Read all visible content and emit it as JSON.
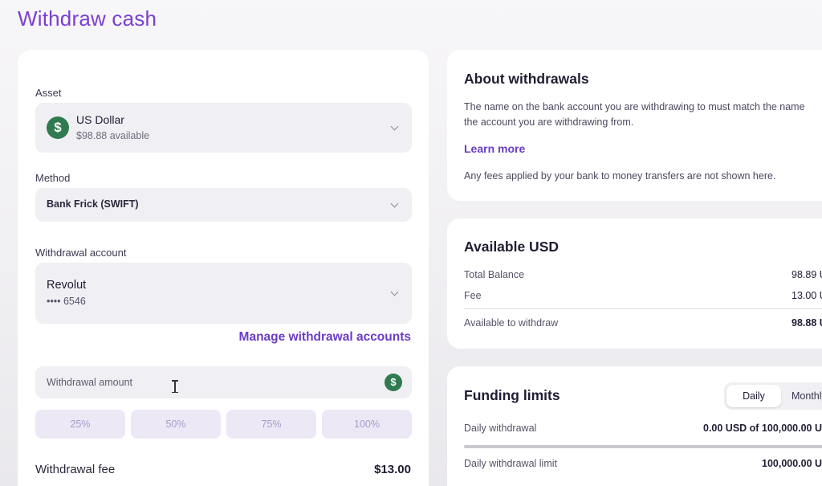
{
  "page": {
    "title": "Withdraw cash"
  },
  "form": {
    "asset_label": "Asset",
    "asset": {
      "name": "US Dollar",
      "available": "$98.88 available",
      "icon": "dollar-icon",
      "icon_color": "#2f7a4f"
    },
    "method_label": "Method",
    "method_value": "Bank Frick (SWIFT)",
    "account_label": "Withdrawal account",
    "account": {
      "name": "Revolut",
      "number": "•••• 6546"
    },
    "manage_link": "Manage withdrawal accounts",
    "amount_placeholder": "Withdrawal amount",
    "percent_buttons": [
      "25%",
      "50%",
      "75%",
      "100%"
    ],
    "fee_label": "Withdrawal fee",
    "fee_value": "$13.00"
  },
  "about": {
    "title": "About withdrawals",
    "text_line1": "The name on the bank account you are withdrawing to must match the name",
    "text_line2": "the account you are withdrawing from.",
    "learn_more": "Learn more",
    "fees_note": "Any fees applied by your bank to money transfers are not shown here."
  },
  "available": {
    "title": "Available USD",
    "rows": [
      {
        "label": "Total Balance",
        "value": "98.89 U"
      },
      {
        "label": "Fee",
        "value": "13.00 U"
      },
      {
        "label": "Available to withdraw",
        "value": "98.88 U"
      }
    ]
  },
  "limits": {
    "title": "Funding limits",
    "toggle": {
      "daily": "Daily",
      "monthly": "Monthly"
    },
    "daily_withdrawal_label": "Daily withdrawal",
    "daily_withdrawal_value": "0.00 USD of 100,000.00 U",
    "daily_limit_label": "Daily withdrawal limit",
    "daily_limit_value": "100,000.00 U",
    "usage_fraction": 0.0
  },
  "colors": {
    "accent": "#7b3fd0",
    "link": "#6a3cc6"
  }
}
